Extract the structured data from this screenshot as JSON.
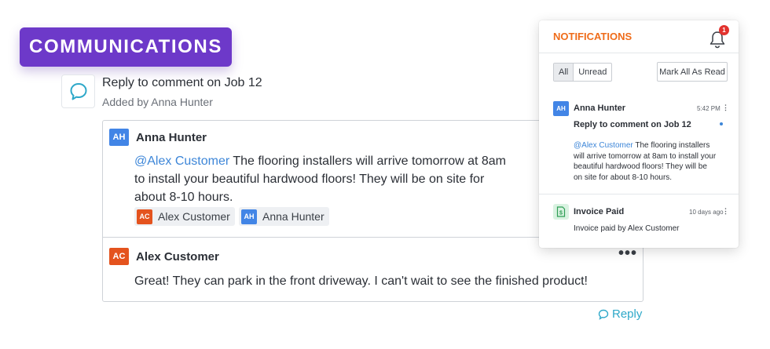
{
  "banner": {
    "label": "COMMUNICATIONS"
  },
  "comment": {
    "title": "Reply to comment on Job 12",
    "added_by": "Added by Anna Hunter",
    "icon": "chat-bubble-icon"
  },
  "thread": {
    "messages": [
      {
        "initials": "AH",
        "author": "Anna Hunter",
        "mention": "@Alex Customer",
        "lines": [
          "The flooring installers will arrive tomorrow at 8am",
          "to install your beautiful hardwood floors! They will be on site for",
          "about 8-10 hours."
        ],
        "chips": [
          {
            "initials": "AC",
            "name": "Alex Customer"
          },
          {
            "initials": "AH",
            "name": "Anna Hunter"
          }
        ]
      },
      {
        "initials": "AC",
        "author": "Alex Customer",
        "text": "Great! They can park in the front driveway. I can't wait to see the finished product!",
        "menu": "•••"
      }
    ],
    "reply_label": "Reply"
  },
  "notifications": {
    "title": "NOTIFICATIONS",
    "badge_count": "1",
    "filters": {
      "all": "All",
      "unread": "Unread"
    },
    "mark_all_label": "Mark All As Read",
    "items": [
      {
        "initials": "AH",
        "name": "Anna Hunter",
        "time": "5:42 PM",
        "subject": "Reply to comment on Job 12",
        "mention": "@Alex Customer",
        "body_lines": [
          "The flooring installers",
          "will arrive tomorrow at 8am to install your",
          "beautiful hardwood floors! They will be",
          "on site for about 8-10 hours."
        ],
        "unread": true
      },
      {
        "icon": "invoice-dollar-icon",
        "name": "Invoice Paid",
        "time": "10 days ago",
        "body": "Invoice paid by Alex Customer"
      }
    ]
  },
  "colors": {
    "banner": "#6d39c9",
    "accent_orange": "#ef6c1a",
    "avatar_blue": "#4285e6",
    "avatar_orange": "#e4531e",
    "mention": "#3d86d8",
    "reply": "#2ea8c9",
    "badge": "#e2322e"
  }
}
